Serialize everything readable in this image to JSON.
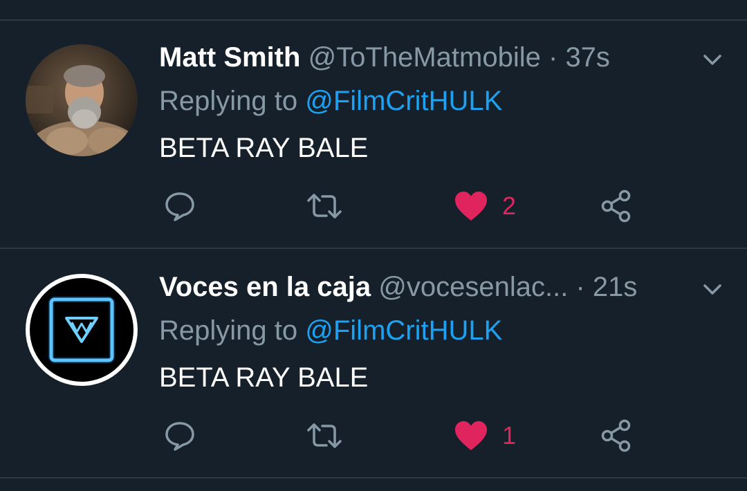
{
  "tweets": [
    {
      "name": "Matt Smith",
      "handle": "@ToTheMatmobile",
      "separator": "·",
      "time": "37s",
      "replying_prefix": "Replying to",
      "replying_to": "@FilmCritHULK",
      "text": "BETA RAY BALE",
      "like_count": "2",
      "liked": true
    },
    {
      "name": "Voces en la caja",
      "handle": "@vocesenlac...",
      "separator": "·",
      "time": "21s",
      "replying_prefix": "Replying to",
      "replying_to": "@FilmCritHULK",
      "text": "BETA RAY BALE",
      "like_count": "1",
      "liked": true
    }
  ],
  "icons": {
    "reply": "reply-icon",
    "retweet": "retweet-icon",
    "like": "heart-icon",
    "share": "share-icon",
    "more": "chevron-down-icon"
  },
  "colors": {
    "background": "#15202b",
    "text": "#ffffff",
    "secondary": "#8899a6",
    "link": "#1da1f2",
    "like": "#e0245e",
    "divider": "#2b3947"
  }
}
